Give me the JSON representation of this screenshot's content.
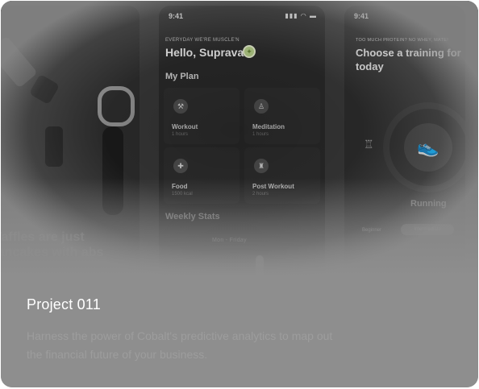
{
  "project": {
    "title": "Project 011",
    "description": "Harness the power of Cobalt's predictive analytics to map out the financial future of your business."
  },
  "left_panel": {
    "headline": "Waffles are just pancakes with abs"
  },
  "center_phone": {
    "time": "9:41",
    "status_icons": "▮▮▮ ◠ ▬",
    "tagline": "EVERYDAY WE'RE MUSCLE'N",
    "greeting": "Hello, Suprava",
    "medal_icon": "medal-icon",
    "plan_title": "My Plan",
    "tiles": [
      {
        "label": "Workout",
        "sub": "1 hours",
        "icon": "dumbbell-icon"
      },
      {
        "label": "Meditation",
        "sub": "1 hours",
        "icon": "meditation-icon"
      },
      {
        "label": "Food",
        "sub": "1500 kcal",
        "icon": "food-icon"
      },
      {
        "label": "Post Workout",
        "sub": "2 hours",
        "icon": "post-workout-icon"
      }
    ],
    "stats_title": "Weekly Stats",
    "stats_sub": "Mon - Friday"
  },
  "right_phone": {
    "time": "9:41",
    "tagline": "TOO MUCH PROTEIN? NO WHEY, MATE!",
    "heading": "Choose a training for today",
    "activity": "Running",
    "activity_icon": "sneaker-icon",
    "kettlebell_icon": "kettlebell-icon",
    "level_a": "Beginner",
    "level_b": "Intermediate"
  },
  "colors": {
    "card_background": "#8e8e8e",
    "accent_purple": "#8f8bd9",
    "medal_green": "#b8d28a"
  }
}
